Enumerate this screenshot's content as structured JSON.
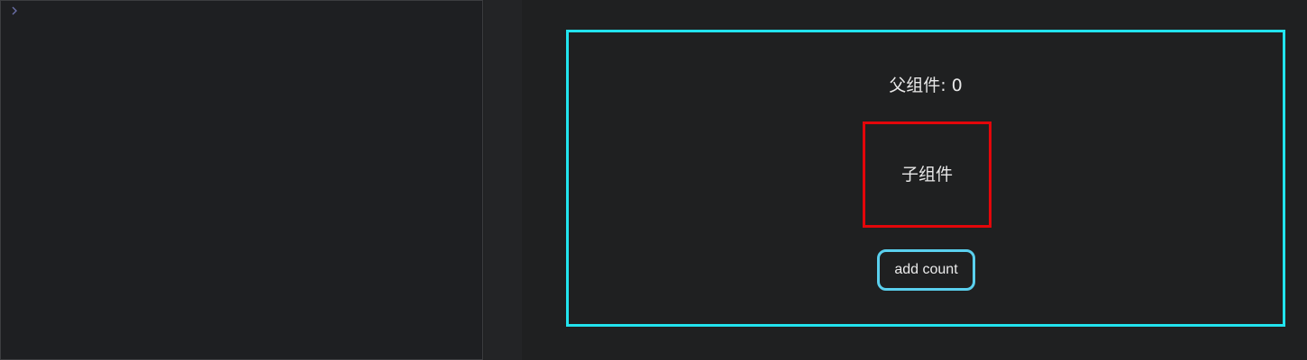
{
  "console": {
    "prompt_icon": "chevron-right-icon"
  },
  "preview": {
    "parent": {
      "title": "父组件: 0",
      "border_color": "#22e3ee"
    },
    "child": {
      "label": "子组件",
      "border_color": "#e3060a"
    },
    "add_button": {
      "label": "add count",
      "border_color": "#5ad0ee"
    }
  }
}
